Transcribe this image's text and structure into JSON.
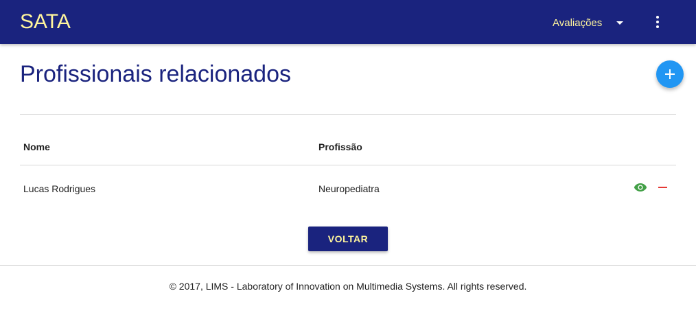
{
  "header": {
    "brand": "SATA",
    "menu_label": "Avaliações",
    "menu_icon": "caret-down-icon",
    "more_icon": "more-vert-icon"
  },
  "main": {
    "title": "Profissionais relacionados",
    "add_icon": "plus-icon",
    "table": {
      "columns": [
        "Nome",
        "Profissão"
      ],
      "rows": [
        {
          "name": "Lucas Rodrigues",
          "profession": "Neuropediatra",
          "actions": [
            "eye-icon",
            "minus-icon"
          ]
        }
      ]
    },
    "back_button": "VOLTAR"
  },
  "footer": {
    "text": "© 2017, LIMS - Laboratory of Innovation on Multimedia Systems. All rights reserved."
  },
  "colors": {
    "primary": "#1a237e",
    "accent_text": "#fff59d",
    "fab": "#2196f3",
    "view_action": "#43a047",
    "remove_action": "#e53935"
  }
}
